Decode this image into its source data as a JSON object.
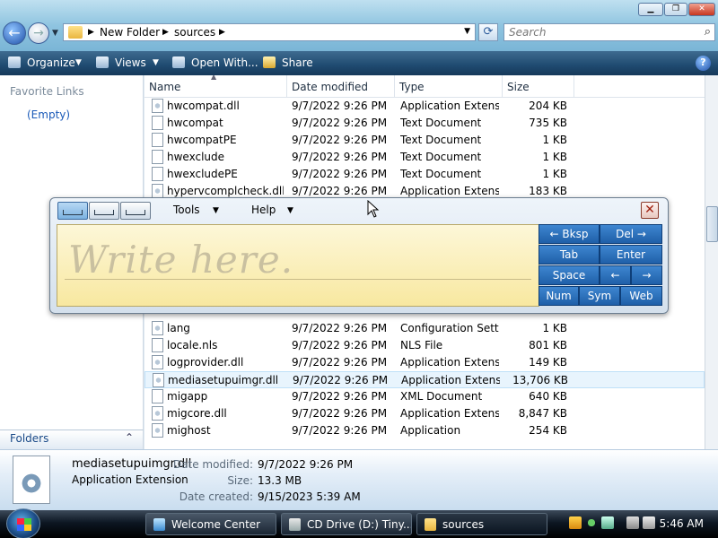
{
  "explorer": {
    "address": {
      "crumbs": [
        "New Folder",
        "sources"
      ]
    },
    "search_placeholder": "Search",
    "toolbar": {
      "organize": "Organize",
      "views": "Views",
      "open_with": "Open With...",
      "share": "Share",
      "help": "?"
    },
    "left_pane": {
      "favorites_header": "Favorite Links",
      "favorites_empty": "(Empty)",
      "folders": "Folders"
    },
    "columns": {
      "name": "Name",
      "date": "Date modified",
      "type": "Type",
      "size": "Size"
    },
    "rows_top": [
      {
        "name": "hwcompat.dll",
        "date": "9/7/2022 9:26 PM",
        "type": "Application Extens...",
        "size": "204 KB",
        "icon": "dll-gear-icon"
      },
      {
        "name": "hwcompat",
        "date": "9/7/2022 9:26 PM",
        "type": "Text Document",
        "size": "735 KB",
        "icon": "text-file-icon"
      },
      {
        "name": "hwcompatPE",
        "date": "9/7/2022 9:26 PM",
        "type": "Text Document",
        "size": "1 KB",
        "icon": "text-file-icon"
      },
      {
        "name": "hwexclude",
        "date": "9/7/2022 9:26 PM",
        "type": "Text Document",
        "size": "1 KB",
        "icon": "text-file-icon"
      },
      {
        "name": "hwexcludePE",
        "date": "9/7/2022 9:26 PM",
        "type": "Text Document",
        "size": "1 KB",
        "icon": "text-file-icon"
      },
      {
        "name": "hypervcomplcheck.dll",
        "date": "9/7/2022 9:26 PM",
        "type": "Application Extens...",
        "size": "183 KB",
        "icon": "dll-gear-icon"
      }
    ],
    "rows_bottom": [
      {
        "name": "lang",
        "date": "9/7/2022 9:26 PM",
        "type": "Configuration Sett...",
        "size": "1 KB",
        "icon": "config-file-icon"
      },
      {
        "name": "locale.nls",
        "date": "9/7/2022 9:26 PM",
        "type": "NLS File",
        "size": "801 KB",
        "icon": "text-file-icon"
      },
      {
        "name": "logprovider.dll",
        "date": "9/7/2022 9:26 PM",
        "type": "Application Extens...",
        "size": "149 KB",
        "icon": "dll-gear-icon"
      },
      {
        "name": "mediasetupuimgr.dll",
        "date": "9/7/2022 9:26 PM",
        "type": "Application Extens...",
        "size": "13,706 KB",
        "icon": "dll-gear-icon",
        "selected": true
      },
      {
        "name": "migapp",
        "date": "9/7/2022 9:26 PM",
        "type": "XML Document",
        "size": "640 KB",
        "icon": "xml-file-icon"
      },
      {
        "name": "migcore.dll",
        "date": "9/7/2022 9:26 PM",
        "type": "Application Extens...",
        "size": "8,847 KB",
        "icon": "dll-gear-icon"
      },
      {
        "name": "mighost",
        "date": "9/7/2022 9:26 PM",
        "type": "Application",
        "size": "254 KB",
        "icon": "app-icon"
      }
    ]
  },
  "details": {
    "filename": "mediasetupuimgr.dll",
    "filetype": "Application Extension",
    "date_modified_label": "Date modified:",
    "date_modified": "9/7/2022 9:26 PM",
    "size_label": "Size:",
    "size": "13.3 MB",
    "date_created_label": "Date created:",
    "date_created": "9/15/2023 5:39 AM"
  },
  "input_panel": {
    "menu_tools": "Tools",
    "menu_help": "Help",
    "write_hint": "Write here.",
    "close": "✕",
    "keys": {
      "bksp": "← Bksp",
      "del": "Del →",
      "tab": "Tab",
      "enter": "Enter",
      "space": "Space",
      "left": "←",
      "right": "→",
      "num": "Num",
      "sym": "Sym",
      "web": "Web"
    }
  },
  "taskbar": {
    "tasks": [
      {
        "label": "Welcome Center"
      },
      {
        "label": "CD Drive (D:) Tiny..."
      },
      {
        "label": "sources"
      }
    ],
    "clock": "5:46 AM"
  },
  "colors": {
    "selection": "#e8f4fd",
    "key_blue": "#1f5fa8",
    "pad_yellow": "#fdf2c0"
  }
}
